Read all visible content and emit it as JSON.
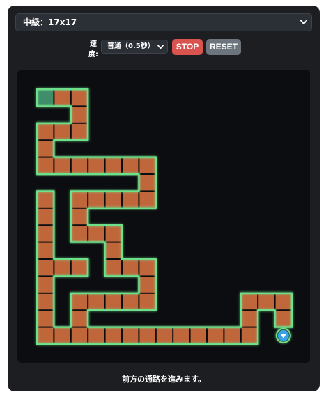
{
  "level_select": {
    "selected": "中級：17x17",
    "chevron_icon": "chevron-down-icon"
  },
  "controls": {
    "speed_label": "速度:",
    "speed_selected": "普通（0.5秒）",
    "stop_label": "STOP",
    "reset_label": "RESET"
  },
  "maze": {
    "cols": 17,
    "rows": 17,
    "start": [
      0,
      0
    ],
    "player": {
      "row": 14,
      "col": 14,
      "facing": "down"
    },
    "path": [
      [
        0,
        0
      ],
      [
        0,
        1
      ],
      [
        0,
        2
      ],
      [
        1,
        2
      ],
      [
        2,
        2
      ],
      [
        2,
        1
      ],
      [
        2,
        0
      ],
      [
        3,
        0
      ],
      [
        4,
        0
      ],
      [
        4,
        1
      ],
      [
        4,
        2
      ],
      [
        4,
        3
      ],
      [
        4,
        4
      ],
      [
        4,
        5
      ],
      [
        4,
        6
      ],
      [
        5,
        6
      ],
      [
        6,
        6
      ],
      [
        6,
        5
      ],
      [
        6,
        4
      ],
      [
        6,
        3
      ],
      [
        6,
        2
      ],
      [
        7,
        2
      ],
      [
        8,
        2
      ],
      [
        8,
        3
      ],
      [
        8,
        4
      ],
      [
        9,
        4
      ],
      [
        10,
        4
      ],
      [
        10,
        5
      ],
      [
        10,
        6
      ],
      [
        11,
        6
      ],
      [
        12,
        6
      ],
      [
        12,
        5
      ],
      [
        12,
        4
      ],
      [
        12,
        3
      ],
      [
        12,
        2
      ],
      [
        13,
        2
      ],
      [
        14,
        2
      ],
      [
        14,
        3
      ],
      [
        14,
        4
      ],
      [
        14,
        5
      ],
      [
        14,
        6
      ],
      [
        14,
        7
      ],
      [
        14,
        8
      ],
      [
        14,
        9
      ],
      [
        14,
        10
      ],
      [
        14,
        11
      ],
      [
        14,
        12
      ],
      [
        13,
        12
      ],
      [
        12,
        12
      ],
      [
        12,
        13
      ],
      [
        12,
        14
      ],
      [
        13,
        14
      ],
      [
        6,
        0
      ],
      [
        7,
        0
      ],
      [
        8,
        0
      ],
      [
        9,
        0
      ],
      [
        10,
        0
      ],
      [
        11,
        0
      ],
      [
        12,
        0
      ],
      [
        13,
        0
      ],
      [
        14,
        0
      ],
      [
        14,
        1
      ],
      [
        10,
        1
      ],
      [
        10,
        2
      ]
    ],
    "colors": {
      "tile": "#c0663b",
      "start_tile": "#3f8d6a",
      "wall_glow": "#6ee08a",
      "background": "#0c0d10",
      "player": "#3aa0e8"
    }
  },
  "status": {
    "message": "前方の通路を進みます。"
  }
}
